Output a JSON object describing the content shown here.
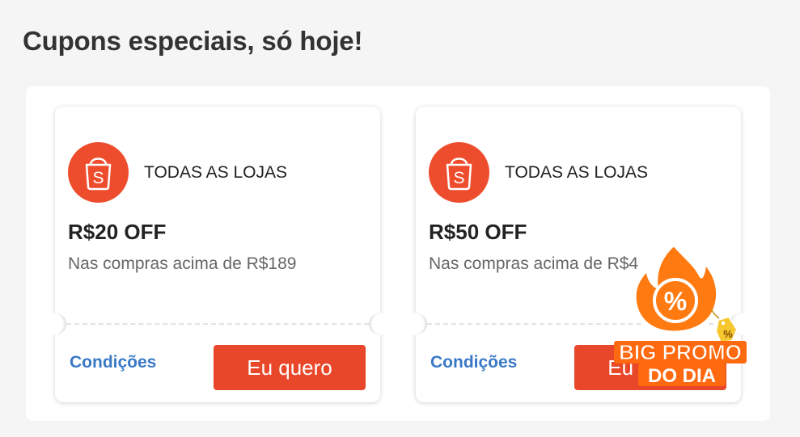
{
  "page": {
    "title": "Cupons especiais, só hoje!"
  },
  "coupons": [
    {
      "store": "TODAS AS LOJAS",
      "amount": "R$20 OFF",
      "condition": "Nas compras acima de R$189",
      "conditions_link": "Condições",
      "button": "Eu quero",
      "logo_letter": "S"
    },
    {
      "store": "TODAS AS LOJAS",
      "amount": "R$50 OFF",
      "condition": "Nas compras acima de R$4",
      "conditions_link": "Condições",
      "button": "Eu quero",
      "logo_letter": "S"
    }
  ],
  "promo_badge": {
    "line1": "BIG PROMO",
    "line2": "DO DIA",
    "symbol": "%",
    "tag_symbol": "%"
  },
  "colors": {
    "brand": "#ee4d2d",
    "button": "#e8472a",
    "link": "#3a79c6",
    "badge_orange": "#ff7a10",
    "tag_yellow": "#f7c72f"
  },
  "icons": [
    "shopee-bag-icon",
    "flame-percent-icon",
    "price-tag-icon"
  ]
}
